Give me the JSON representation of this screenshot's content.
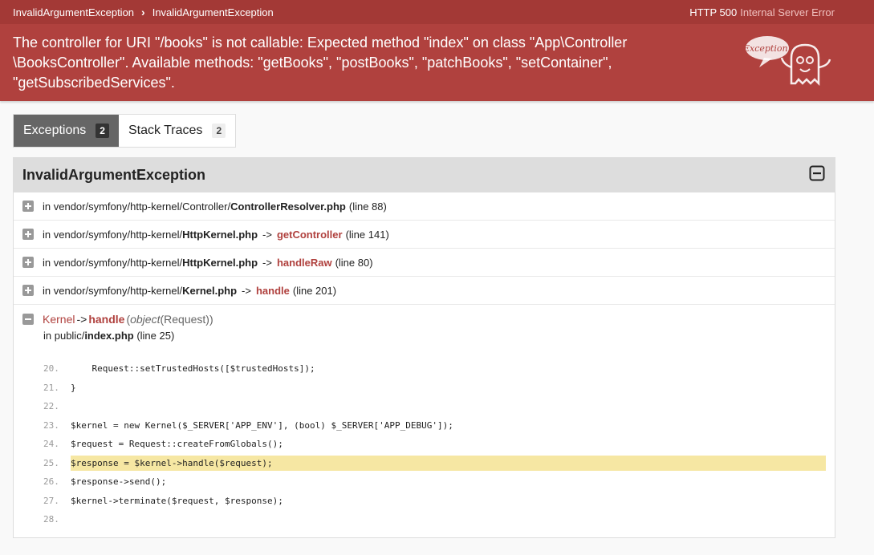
{
  "breadcrumb": {
    "first": "InvalidArgumentException",
    "second": "InvalidArgumentException"
  },
  "status": {
    "code": "HTTP 500",
    "text": "Internal Server Error"
  },
  "message_lines": [
    "The controller for URI \"/books\" is not callable: Expected method \"index\" on class \"App\\Controller",
    "\\BooksController\". Available methods: \"getBooks\", \"postBooks\", \"patchBooks\", \"setContainer\",",
    "\"getSubscribedServices\"."
  ],
  "ghost_label": "Exception!",
  "tabs": [
    {
      "label": "Exceptions",
      "count": "2"
    },
    {
      "label": "Stack Traces",
      "count": "2"
    }
  ],
  "panel": {
    "title": "InvalidArgumentException",
    "rows": [
      {
        "prefix": "in vendor/symfony/http-kernel/Controller/",
        "file": "ControllerResolver.php",
        "method": "",
        "line": "(line 88)"
      },
      {
        "prefix": "in vendor/symfony/http-kernel/",
        "file": "HttpKernel.php",
        "method": "getController",
        "line": "(line 141)"
      },
      {
        "prefix": "in vendor/symfony/http-kernel/",
        "file": "HttpKernel.php",
        "method": "handleRaw",
        "line": "(line 80)"
      },
      {
        "prefix": "in vendor/symfony/http-kernel/",
        "file": "Kernel.php",
        "method": "handle",
        "line": "(line 201)"
      }
    ],
    "arrow": "->",
    "expanded": {
      "class": "Kernel",
      "arrow": "->",
      "method": "handle",
      "args_open": "(",
      "args_type": "object",
      "args_rest": "(Request))",
      "file_prefix": "in public/",
      "file": "index.php",
      "line": "(line 25)"
    },
    "code": [
      {
        "num": "20.",
        "text": "    Request::setTrustedHosts([$trustedHosts]);"
      },
      {
        "num": "21.",
        "text": "}"
      },
      {
        "num": "22.",
        "text": ""
      },
      {
        "num": "23.",
        "text": "$kernel = new Kernel($_SERVER['APP_ENV'], (bool) $_SERVER['APP_DEBUG']);"
      },
      {
        "num": "24.",
        "text": "$request = Request::createFromGlobals();"
      },
      {
        "num": "25.",
        "text": "$response = $kernel->handle($request);",
        "highlight": true
      },
      {
        "num": "26.",
        "text": "$response->send();"
      },
      {
        "num": "27.",
        "text": "$kernel->terminate($request, $response);"
      },
      {
        "num": "28.",
        "text": ""
      }
    ]
  },
  "colors": {
    "header": "#b0413e",
    "highlight": "#f6e7a3",
    "accent": "#b0413e"
  }
}
